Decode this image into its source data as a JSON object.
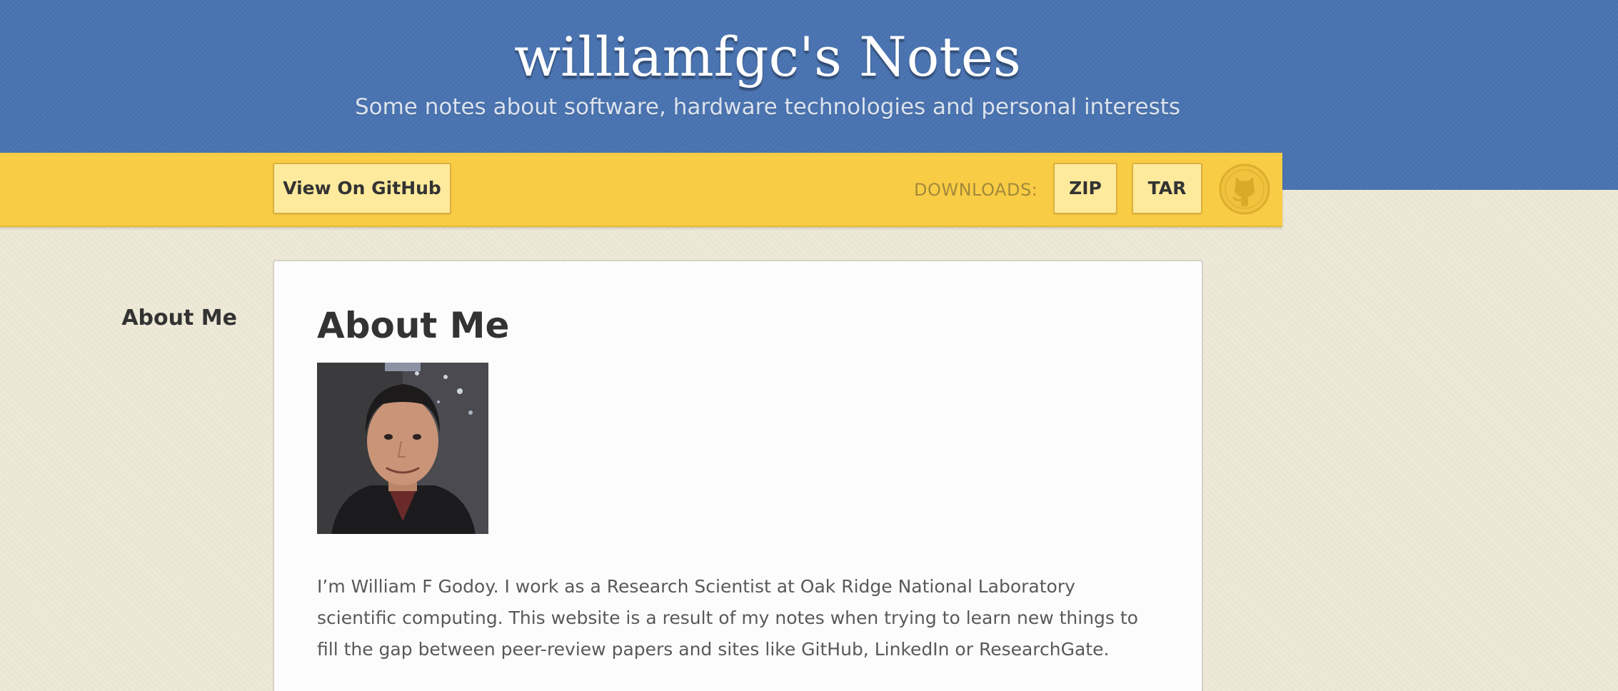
{
  "header": {
    "title": "williamfgc's Notes",
    "tagline": "Some notes about software, hardware technologies and personal interests"
  },
  "toolbar": {
    "github_label": "View On GitHub",
    "downloads_label": "DOWNLOADS:",
    "zip_label": "ZIP",
    "tar_label": "TAR",
    "logo_icon": "github-octocat-icon"
  },
  "sidebar": {
    "items": [
      {
        "label": "About Me"
      }
    ]
  },
  "main": {
    "title": "About Me",
    "portrait_icon": "profile-photo",
    "bio": "I’m William F Godoy. I work as a Research Scientist at Oak Ridge National Laboratory scientific computing. This website is a result of my notes when trying to learn new things to fill the gap between peer-review papers and sites like GitHub, LinkedIn or ResearchGate."
  },
  "colors": {
    "header_blue": "#4872af",
    "toolbar_yellow": "#f9cc45",
    "button_fill": "#fdea9c",
    "page_background": "#ebe6d3"
  }
}
